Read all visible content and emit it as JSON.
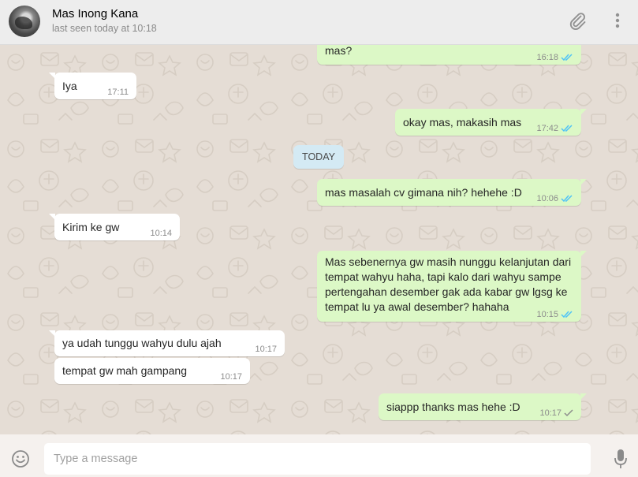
{
  "header": {
    "contact_name": "Mas Inong Kana",
    "last_seen": "last seen today at 10:18"
  },
  "colors": {
    "chat_bg": "#e5ddd5",
    "outgoing_bubble": "#dcf8c6",
    "incoming_bubble": "#ffffff",
    "read_tick": "#4fc3f7",
    "day_badge": "#d4eaf4"
  },
  "day_divider": "TODAY",
  "messages": [
    {
      "dir": "out",
      "text": "mas?",
      "time": "16:18",
      "status": "read"
    },
    {
      "dir": "in",
      "text": "Iya",
      "time": "17:11"
    },
    {
      "dir": "out",
      "text": "okay mas, makasih mas",
      "time": "17:42",
      "status": "read"
    },
    {
      "dir": "out",
      "text": "mas masalah cv gimana nih? hehehe :D",
      "time": "10:06",
      "status": "read"
    },
    {
      "dir": "in",
      "text": "Kirim ke gw",
      "time": "10:14"
    },
    {
      "dir": "out",
      "lines": [
        "Mas sebenernya gw masih nunggu kelanjutan dari",
        "tempat wahyu haha, tapi kalo dari wahyu sampe",
        "pertengahan desember gak ada kabar gw lgsg ke",
        "tempat lu ya awal desember? hahaha"
      ],
      "time": "10:15",
      "status": "read"
    },
    {
      "dir": "in",
      "text": "ya udah tunggu wahyu dulu ajah",
      "time": "10:17"
    },
    {
      "dir": "in",
      "text": "tempat gw mah gampang",
      "time": "10:17"
    },
    {
      "dir": "out",
      "text": "siappp thanks mas hehe :D",
      "time": "10:17",
      "status": "sent"
    }
  ],
  "composer": {
    "placeholder": "Type a message"
  },
  "icons": {
    "attach": "paperclip-icon",
    "menu": "kebab-menu-icon",
    "emoji": "smiley-icon",
    "mic": "microphone-icon"
  }
}
